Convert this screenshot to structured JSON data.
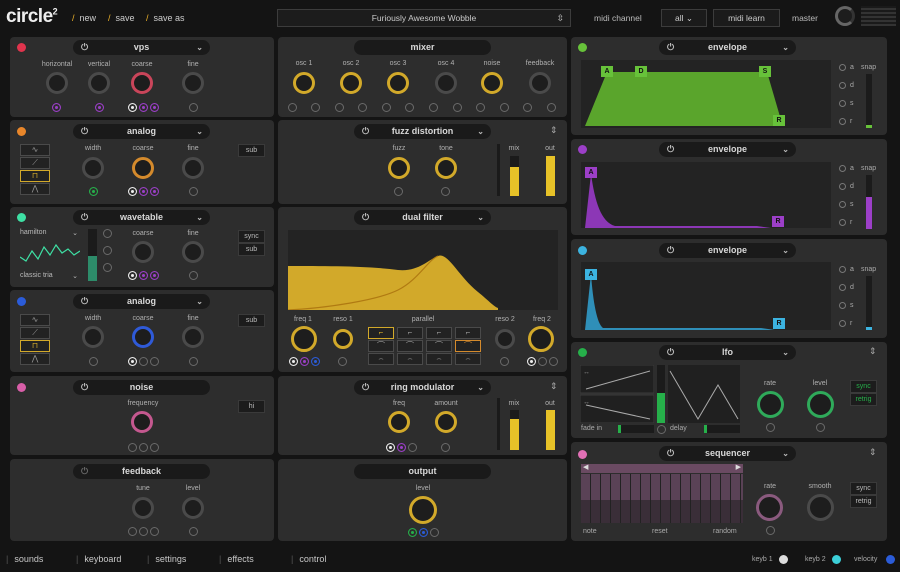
{
  "app": {
    "logo": "circle",
    "logo_sup": "2"
  },
  "topbar": {
    "new": "new",
    "save": "save",
    "save_as": "save as",
    "preset": "Furiously Awesome Wobble",
    "midi_channel_label": "midi channel",
    "midi_channel_value": "all",
    "midi_learn": "midi learn",
    "master": "master"
  },
  "osc1": {
    "title": "vps",
    "k1": "horizontal",
    "k2": "vertical",
    "k3": "coarse",
    "k4": "fine"
  },
  "osc2": {
    "title": "analog",
    "k1": "width",
    "k2": "coarse",
    "k3": "fine",
    "sub": "sub"
  },
  "osc3": {
    "title": "wavetable",
    "wt": "hamilton",
    "wt2": "classic tria",
    "k1": "coarse",
    "k2": "fine",
    "sync": "sync",
    "sub": "sub"
  },
  "osc4": {
    "title": "analog",
    "k1": "width",
    "k2": "coarse",
    "k3": "fine",
    "sub": "sub"
  },
  "noise": {
    "title": "noise",
    "k1": "frequency",
    "hi": "hi"
  },
  "feedback": {
    "title": "feedback",
    "k1": "tune",
    "k2": "level"
  },
  "mixer": {
    "title": "mixer",
    "k1": "osc 1",
    "k2": "osc 2",
    "k3": "osc 3",
    "k4": "osc 4",
    "k5": "noise",
    "k6": "feedback"
  },
  "fx1": {
    "title": "fuzz distortion",
    "k1": "fuzz",
    "k2": "tone",
    "mix": "mix",
    "out": "out"
  },
  "filter": {
    "title": "dual filter",
    "k1": "freq 1",
    "k2": "reso 1",
    "mode": "parallel",
    "k3": "reso 2",
    "k4": "freq 2"
  },
  "fx2": {
    "title": "ring modulator",
    "k1": "freq",
    "k2": "amount",
    "mix": "mix",
    "out": "out"
  },
  "output": {
    "title": "output",
    "k1": "level"
  },
  "env1": {
    "title": "envelope",
    "a": "a",
    "d": "d",
    "s": "s",
    "r": "r",
    "snap": "snap"
  },
  "env2": {
    "title": "envelope",
    "a": "a",
    "d": "d",
    "s": "s",
    "r": "r",
    "snap": "snap"
  },
  "env3": {
    "title": "envelope",
    "a": "a",
    "d": "d",
    "s": "s",
    "r": "r",
    "snap": "snap"
  },
  "env_nodes": {
    "A": "A",
    "D": "D",
    "S": "S",
    "R": "R"
  },
  "lfo": {
    "title": "lfo",
    "fade_in": "fade in",
    "delay": "delay",
    "rate": "rate",
    "level": "level",
    "sync": "sync",
    "retrig": "retrig"
  },
  "seq": {
    "title": "sequencer",
    "note": "note",
    "reset": "reset",
    "random": "random",
    "rate": "rate",
    "smooth": "smooth",
    "sync": "sync",
    "retrig": "retrig"
  },
  "bottom": {
    "sounds": "sounds",
    "keyboard": "keyboard",
    "settings": "settings",
    "effects": "effects",
    "control": "control",
    "keyb1": "keyb 1",
    "keyb2": "keyb 2",
    "velocity": "velocity"
  },
  "colors": {
    "osc1": "#e0344d",
    "osc2": "#e8862a",
    "osc3": "#3ee0a4",
    "osc4": "#2b5cd9",
    "noise": "#d85ea8",
    "env1": "#67c23a",
    "env2": "#9c3fc8",
    "env3": "#3cb3e0",
    "lfo": "#26b04a",
    "seq": "#e270b6",
    "yellow": "#d2a92a"
  },
  "icons": {
    "power": "power-icon",
    "chevron": "chevron-down-icon",
    "updown": "up-down-arrows-icon"
  }
}
